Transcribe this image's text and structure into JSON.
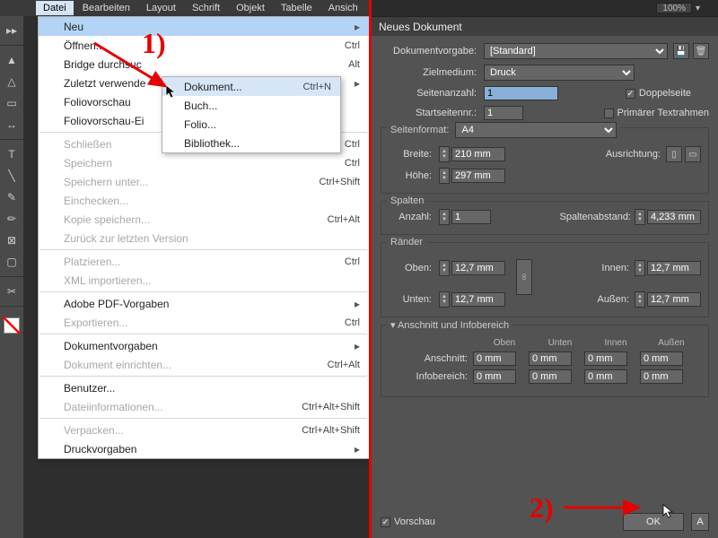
{
  "menubar": [
    "Datei",
    "Bearbeiten",
    "Layout",
    "Schrift",
    "Objekt",
    "Tabelle",
    "Ansich"
  ],
  "filemenu": {
    "groups": [
      [
        {
          "label": "Neu",
          "hover": true,
          "arrow": true
        },
        {
          "label": "Öffnen...",
          "sc": "Ctrl"
        },
        {
          "label": "Bridge durchsuc",
          "sc": "Alt"
        },
        {
          "label": "Zuletzt verwende",
          "arrow": true
        },
        {
          "label": "Foliovorschau"
        },
        {
          "label": "Foliovorschau-Ei"
        }
      ],
      [
        {
          "label": "Schließen",
          "disabled": true,
          "sc": "Ctrl"
        },
        {
          "label": "Speichern",
          "disabled": true,
          "sc": "Ctrl"
        },
        {
          "label": "Speichern unter...",
          "disabled": true,
          "sc": "Ctrl+Shift"
        },
        {
          "label": "Einchecken...",
          "disabled": true
        },
        {
          "label": "Kopie speichern...",
          "disabled": true,
          "sc": "Ctrl+Alt"
        },
        {
          "label": "Zurück zur letzten Version",
          "disabled": true
        }
      ],
      [
        {
          "label": "Platzieren...",
          "disabled": true,
          "sc": "Ctrl"
        },
        {
          "label": "XML importieren...",
          "disabled": true
        }
      ],
      [
        {
          "label": "Adobe PDF-Vorgaben",
          "arrow": true
        },
        {
          "label": "Exportieren...",
          "disabled": true,
          "sc": "Ctrl"
        }
      ],
      [
        {
          "label": "Dokumentvorgaben",
          "arrow": true
        },
        {
          "label": "Dokument einrichten...",
          "disabled": true,
          "sc": "Ctrl+Alt"
        }
      ],
      [
        {
          "label": "Benutzer..."
        },
        {
          "label": "Dateiinformationen...",
          "disabled": true,
          "sc": "Ctrl+Alt+Shift"
        }
      ],
      [
        {
          "label": "Verpacken...",
          "disabled": true,
          "sc": "Ctrl+Alt+Shift"
        },
        {
          "label": "Druckvorgaben",
          "arrow": true
        }
      ]
    ]
  },
  "submenu": [
    {
      "label": "Dokument...",
      "sc": "Ctrl+N",
      "hover": true
    },
    {
      "label": "Buch..."
    },
    {
      "label": "Folio..."
    },
    {
      "label": "Bibliothek..."
    }
  ],
  "dialog": {
    "title": "Neues Dokument",
    "preset_label": "Dokumentvorgabe:",
    "preset_value": "[Standard]",
    "intent_label": "Zielmedium:",
    "intent_value": "Druck",
    "pages_label": "Seitenanzahl:",
    "pages_value": "1",
    "facing_label": "Doppelseite",
    "startpage_label": "Startseitennr.:",
    "startpage_value": "1",
    "primarytf_label": "Primärer Textrahmen",
    "pageformat_title": "Seitenformat:",
    "pageformat_value": "A4",
    "width_label": "Breite:",
    "width_value": "210 mm",
    "height_label": "Höhe:",
    "height_value": "297 mm",
    "orient_label": "Ausrichtung:",
    "columns_title": "Spalten",
    "col_count_label": "Anzahl:",
    "col_count_value": "1",
    "col_gutter_label": "Spaltenabstand:",
    "col_gutter_value": "4,233 mm",
    "margins_title": "Ränder",
    "m_top_label": "Oben:",
    "m_top": "12,7 mm",
    "m_bottom_label": "Unten:",
    "m_bottom": "12,7 mm",
    "m_inner_label": "Innen:",
    "m_inner": "12,7 mm",
    "m_outer_label": "Außen:",
    "m_outer": "12,7 mm",
    "bleed_title": "Anschnitt und Infobereich",
    "col_top": "Oben",
    "col_bottom": "Unten",
    "col_inner": "Innen",
    "col_outer": "Außen",
    "bleed_label": "Anschnitt:",
    "bleed_v": "0 mm",
    "slug_label": "Infobereich:",
    "slug_v": "0 mm",
    "preview_label": "Vorschau",
    "ok_label": "OK"
  },
  "anno": {
    "one": "1)",
    "two": "2)"
  },
  "panelstrip": {
    "zoom": "100%"
  }
}
